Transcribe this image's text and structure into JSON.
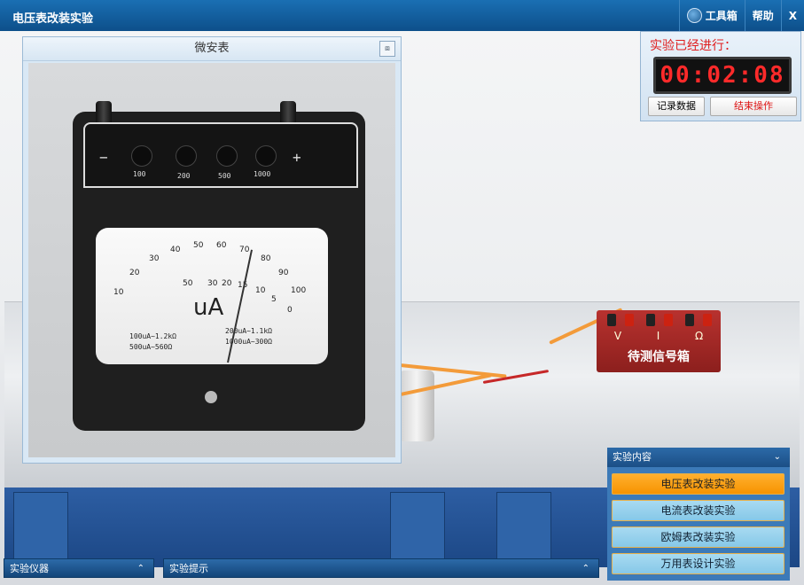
{
  "app": {
    "title": "电压表改装实验"
  },
  "toolbar": {
    "toolbox_label": "工具箱",
    "help_label": "帮助",
    "close_label": "X"
  },
  "timer": {
    "label": "实验已经进行：",
    "time": "00:02:08",
    "record_label": "记录数据",
    "end_label": "结束操作"
  },
  "meter_panel": {
    "title": "微安表",
    "close_icon": "restore-icon",
    "terminals": {
      "minus": "−",
      "plus": "+"
    },
    "range_knobs": [
      "100",
      "200",
      "500",
      "1000"
    ],
    "unit": "uA",
    "scale_top": [
      "10",
      "20",
      "30",
      "40",
      "50",
      "60",
      "70",
      "80",
      "90",
      "100"
    ],
    "scale_bottom": [
      "0",
      "5",
      "10",
      "15",
      "20",
      "30",
      "50"
    ],
    "ranges_left": [
      "100uA~1.2kΩ",
      "500uA~560Ω"
    ],
    "ranges_right": [
      "200uA~1.1kΩ",
      "1000uA~300Ω"
    ]
  },
  "scene": {
    "signal_box": {
      "label": "待测信号箱",
      "terminals": [
        "V",
        "I",
        "Ω"
      ]
    }
  },
  "experiment_content": {
    "title": "实验内容",
    "items": [
      {
        "label": "电压表改装实验",
        "active": true
      },
      {
        "label": "电流表改装实验",
        "active": false
      },
      {
        "label": "欧姆表改装实验",
        "active": false
      },
      {
        "label": "万用表设计实验",
        "active": false
      }
    ]
  },
  "bottom": {
    "instruments_label": "实验仪器",
    "hints_label": "实验提示"
  },
  "colors": {
    "accent": "#1a6fb3",
    "active_item": "#f79300",
    "timer_digits": "#ff2a2a"
  }
}
